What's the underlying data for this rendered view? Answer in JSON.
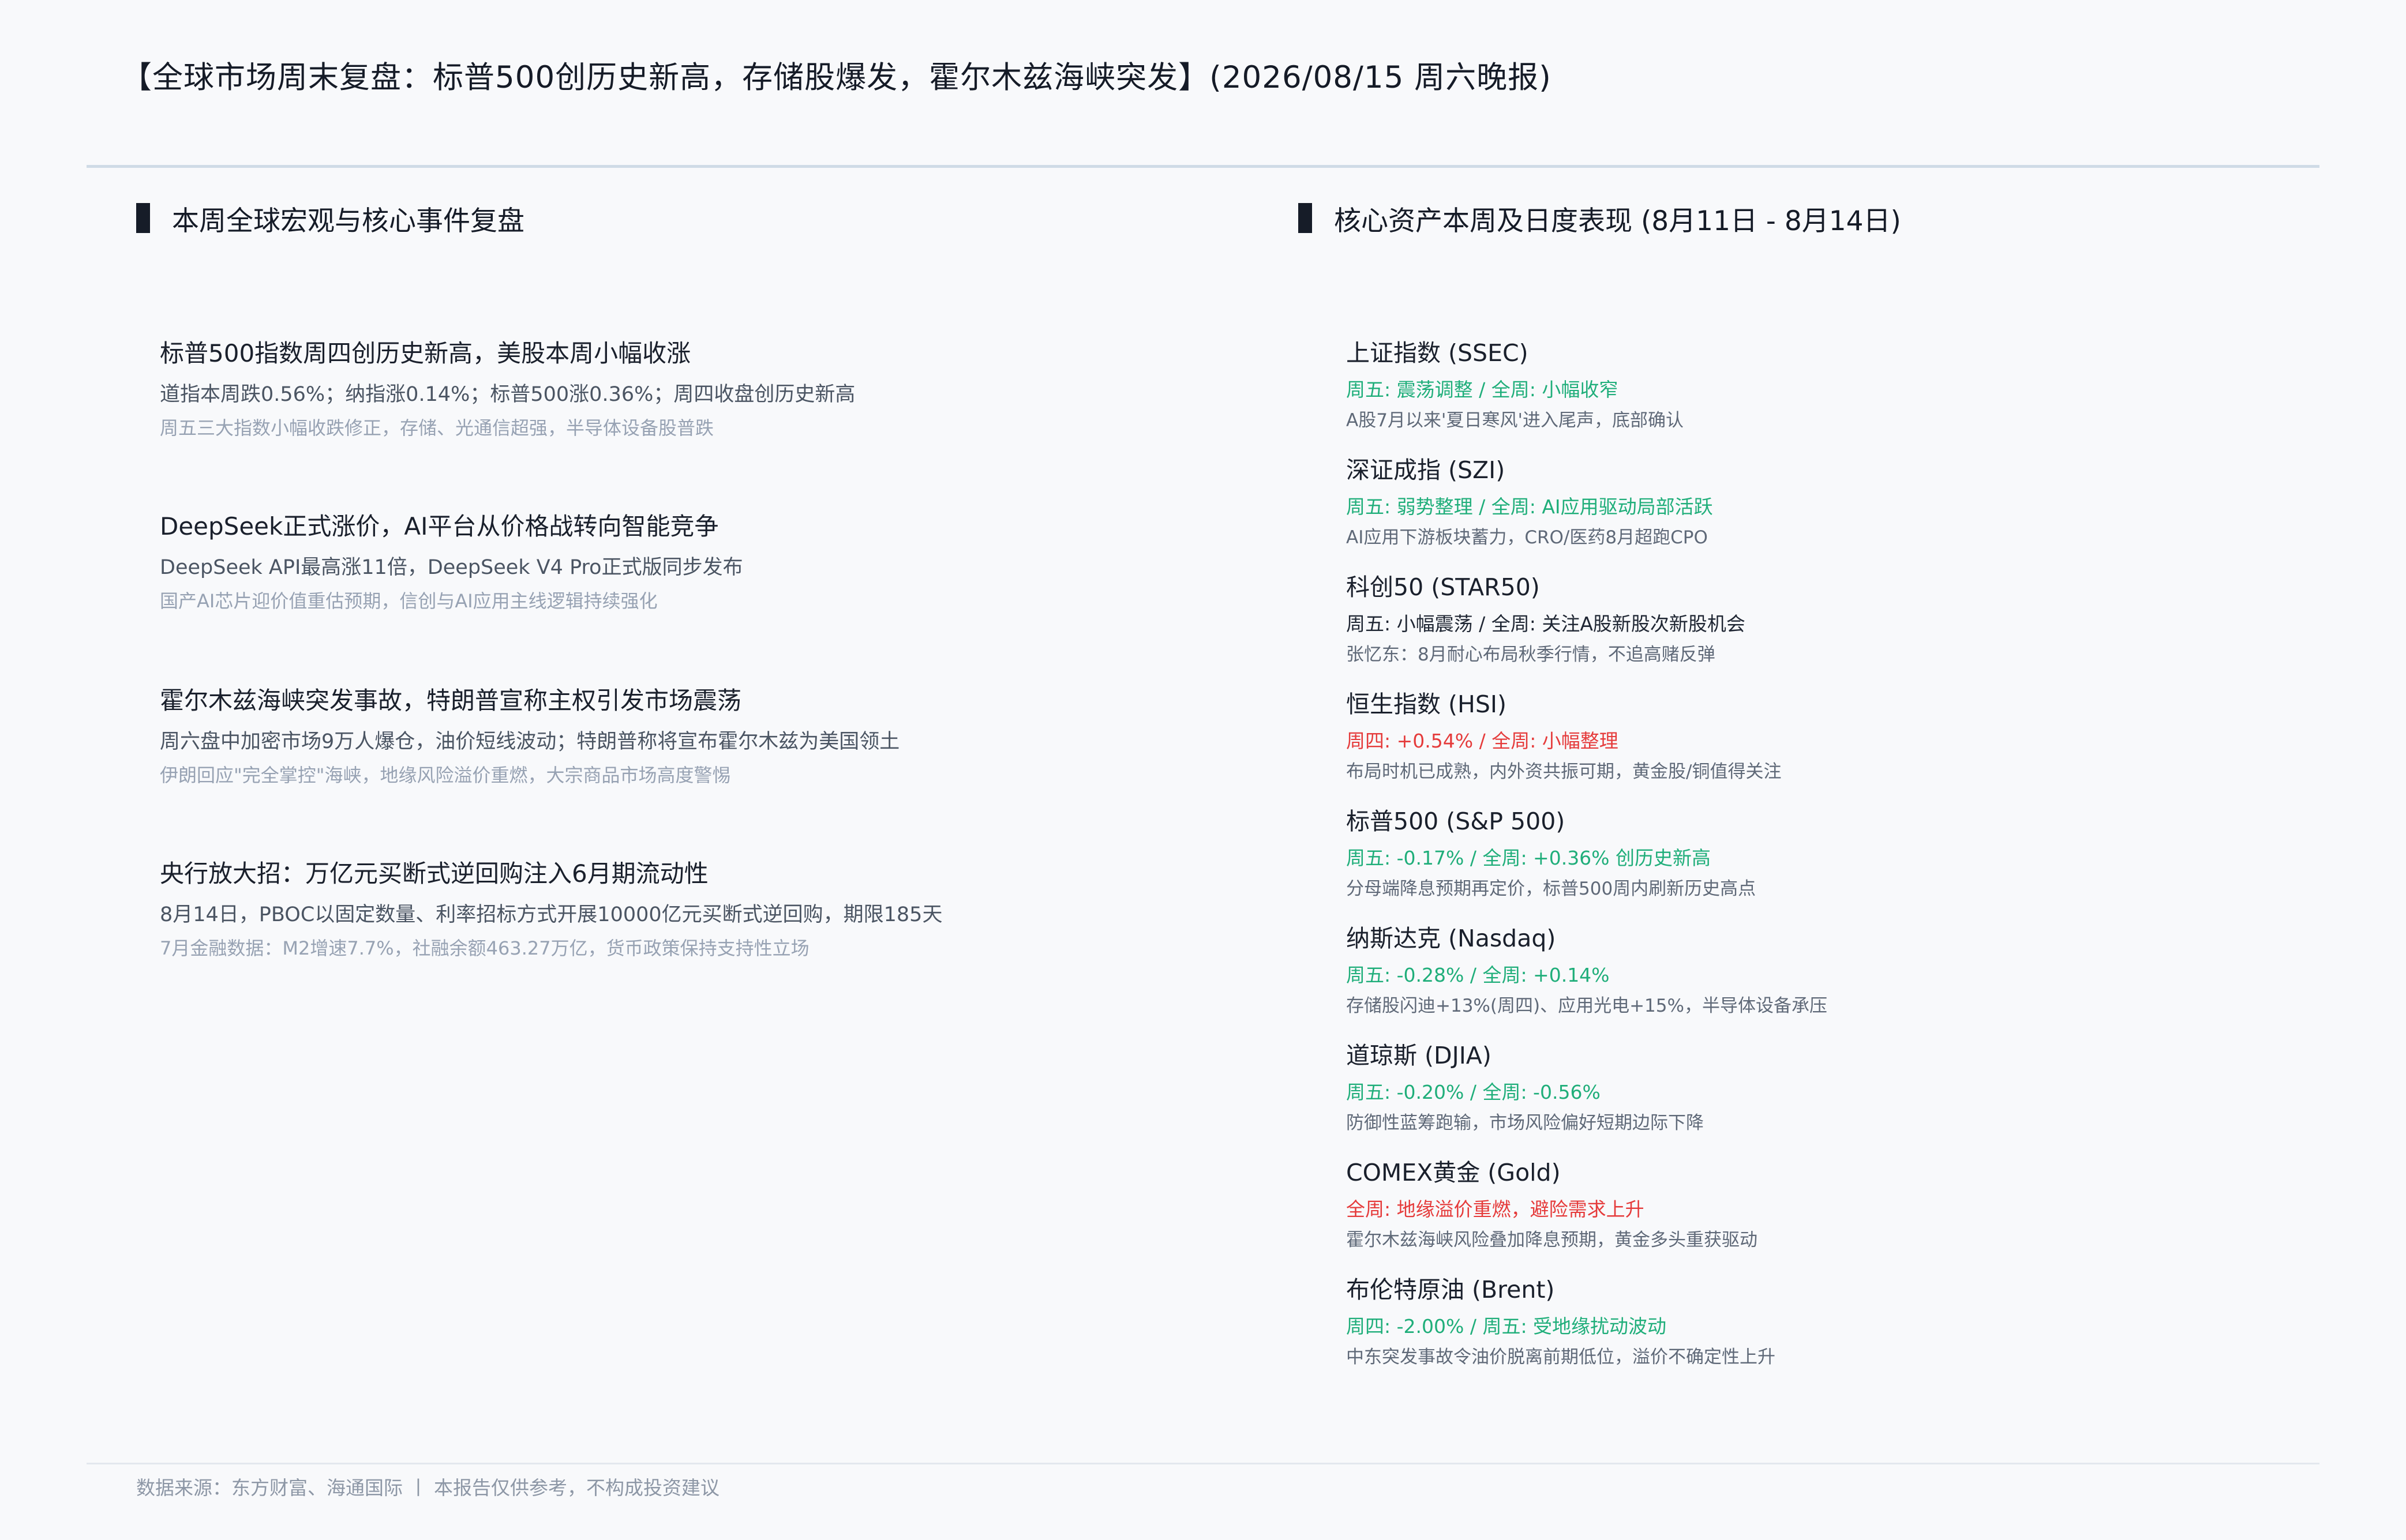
{
  "report": {
    "title": "【全球市场周末复盘：标普500创历史新高，存储股爆发，霍尔木兹海峡突发】(2026/08/15 周六晚报)"
  },
  "left_section": {
    "heading": "本周全球宏观与核心事件复盘",
    "events": [
      {
        "title": "标普500指数周四创历史新高，美股本周小幅收涨",
        "main": "道指本周跌0.56%；纳指涨0.14%；标普500涨0.36%；周四收盘创历史新高",
        "sub": "周五三大指数小幅收跌修正，存储、光通信超强，半导体设备股普跌"
      },
      {
        "title": "DeepSeek正式涨价，AI平台从价格战转向智能竞争",
        "main": "DeepSeek API最高涨11倍，DeepSeek V4 Pro正式版同步发布",
        "sub": "国产AI芯片迎价值重估预期，信创与AI应用主线逻辑持续强化"
      },
      {
        "title": "霍尔木兹海峡突发事故，特朗普宣称主权引发市场震荡",
        "main": "周六盘中加密市场9万人爆仓，油价短线波动；特朗普称将宣布霍尔木兹为美国领土",
        "sub": "伊朗回应\"完全掌控\"海峡，地缘风险溢价重燃，大宗商品市场高度警惕"
      },
      {
        "title": "央行放大招：万亿元买断式逆回购注入6月期流动性",
        "main": "8月14日，PBOC以固定数量、利率招标方式开展10000亿元买断式逆回购，期限185天",
        "sub": "7月金融数据：M2增速7.7%，社融余额463.27万亿，货币政策保持支持性立场"
      }
    ]
  },
  "right_section": {
    "heading": "核心资产本周及日度表现 (8月11日 - 8月14日)",
    "assets": [
      {
        "name": "上证指数 (SSEC)",
        "perf": "周五: 震荡调整  / 全周: 小幅收窄",
        "perf_color": "green",
        "note": "A股7月以来'夏日寒风'进入尾声，底部确认"
      },
      {
        "name": "深证成指 (SZI)",
        "perf": "周五: 弱势整理  / 全周: AI应用驱动局部活跃",
        "perf_color": "green",
        "note": "AI应用下游板块蓄力，CRO/医药8月超跑CPO"
      },
      {
        "name": "科创50 (STAR50)",
        "perf": "周五: 小幅震荡 / 全周: 关注A股新股次新股机会",
        "perf_color": "dark",
        "note": "张忆东：8月耐心布局秋季行情，不追高赌反弹"
      },
      {
        "name": "恒生指数 (HSI)",
        "perf": "周四: +0.54%  / 全周: 小幅整理",
        "perf_color": "red",
        "note": "布局时机已成熟，内外资共振可期，黄金股/铜值得关注"
      },
      {
        "name": "标普500 (S&P 500)",
        "perf": "周五: -0.17%  / 全周: +0.36%  创历史新高",
        "perf_color": "green",
        "note": "分母端降息预期再定价，标普500周内刷新历史高点"
      },
      {
        "name": "纳斯达克 (Nasdaq)",
        "perf": "周五: -0.28%  / 全周: +0.14%",
        "perf_color": "green",
        "note": "存储股闪迪+13%(周四)、应用光电+15%，半导体设备承压"
      },
      {
        "name": "道琼斯 (DJIA)",
        "perf": "周五: -0.20%  / 全周: -0.56%",
        "perf_color": "green",
        "note": "防御性蓝筹跑输，市场风险偏好短期边际下降"
      },
      {
        "name": "COMEX黄金 (Gold)",
        "perf": "全周: 地缘溢价重燃，避险需求上升",
        "perf_color": "red",
        "note": "霍尔木兹海峡风险叠加降息预期，黄金多头重获驱动"
      },
      {
        "name": "布伦特原油 (Brent)",
        "perf": "周四: -2.00%  / 周五: 受地缘扰动波动",
        "perf_color": "green",
        "note": "中东突发事故令油价脱离前期低位，溢价不确定性上升"
      }
    ]
  },
  "footer": {
    "text": "数据来源：东方财富、海通国际 丨 本报告仅供参考，不构成投资建议"
  }
}
